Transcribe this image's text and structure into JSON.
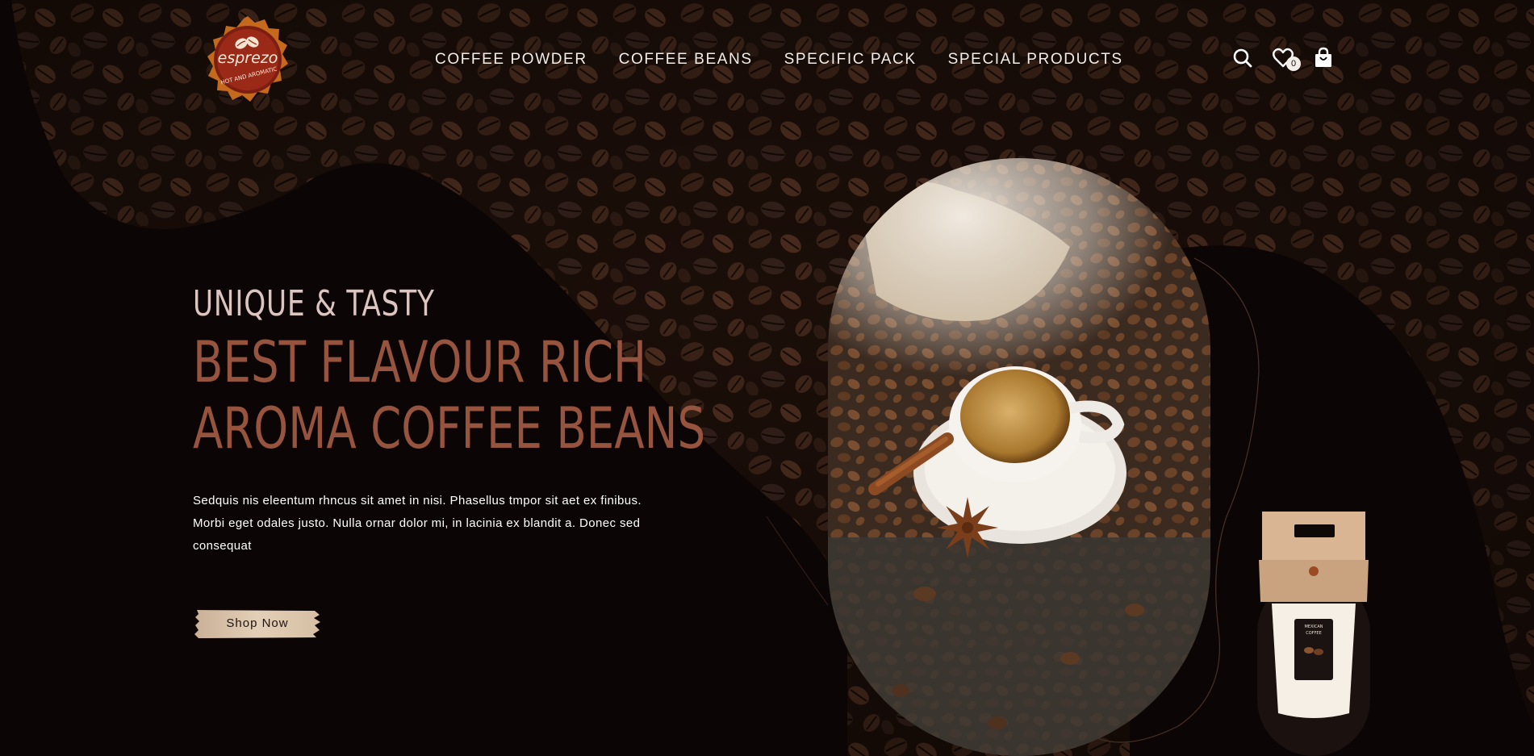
{
  "brand": {
    "logo_word": "esprezo",
    "logo_tagline": "HOT AND AROMATIC"
  },
  "nav": {
    "items": [
      {
        "label": "COFFEE POWDER"
      },
      {
        "label": "COFFEE BEANS"
      },
      {
        "label": "SPECIFIC PACK"
      },
      {
        "label": "SPECIAL PRODUCTS"
      }
    ]
  },
  "header_icons": {
    "search": "search-icon",
    "wishlist": "heart-icon",
    "wishlist_count": "0",
    "cart": "bag-icon"
  },
  "hero": {
    "pretitle": "UNIQUE & TASTY",
    "title_line1": "BEST FLAVOUR RICH",
    "title_line2": "AROMA COFFEE BEANS",
    "description": "Sedquis nis eleentum rhncus sit amet in nisi. Phasellus tmpor sit aet ex finibus. Morbi eget odales justo. Nulla ornar dolor mi, in lacinia ex blandit a. Donec sed consequat",
    "cta_label": "Shop Now"
  },
  "product_pack": {
    "label_line1": "MEXICAN",
    "label_line2": "COFFEE"
  },
  "colors": {
    "background": "#0b0605",
    "accent": "#96533d",
    "pretitle": "#dcc5c1",
    "nav_text": "#f2ede9",
    "cta_bg": "#d8c2a8"
  }
}
